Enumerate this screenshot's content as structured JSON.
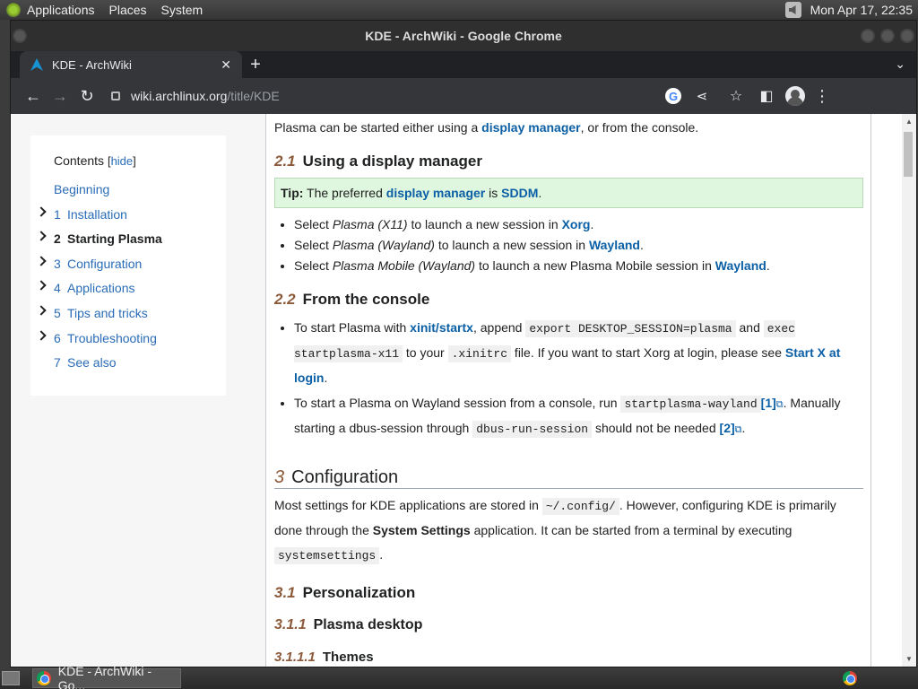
{
  "top_panel": {
    "menus": [
      "Applications",
      "Places",
      "System"
    ],
    "clock": "Mon Apr 17, 22:35"
  },
  "window": {
    "title": "KDE - ArchWiki - Google Chrome"
  },
  "tab": {
    "title": "KDE - ArchWiki",
    "close": "✕",
    "new": "+"
  },
  "address": {
    "host": "wiki.archlinux.org",
    "path": "/title/KDE"
  },
  "toc": {
    "title": "Contents",
    "hide_label": "hide",
    "items": [
      {
        "num": "",
        "label": "Beginning"
      },
      {
        "num": "1",
        "label": "Installation"
      },
      {
        "num": "2",
        "label": "Starting Plasma"
      },
      {
        "num": "3",
        "label": "Configuration"
      },
      {
        "num": "4",
        "label": "Applications"
      },
      {
        "num": "5",
        "label": "Tips and tricks"
      },
      {
        "num": "6",
        "label": "Troubleshooting"
      },
      {
        "num": "7",
        "label": "See also"
      }
    ]
  },
  "article": {
    "intro": {
      "pre": "Plasma can be started either using a ",
      "link": "display manager",
      "post": ", or from the console."
    },
    "s21": {
      "num": "2.1",
      "title": "Using a display manager"
    },
    "tip": {
      "label": "Tip:",
      "pre": " The preferred ",
      "link1": "display manager",
      "mid": " is ",
      "link2": "SDDM",
      "post": "."
    },
    "dm_list": [
      {
        "pre": "Select ",
        "em": "Plasma (X11)",
        "mid": " to launch a new session in ",
        "link": "Xorg",
        "post": "."
      },
      {
        "pre": "Select ",
        "em": "Plasma (Wayland)",
        "mid": " to launch a new session in ",
        "link": "Wayland",
        "post": "."
      },
      {
        "pre": "Select ",
        "em": "Plasma Mobile (Wayland)",
        "mid": " to launch a new Plasma Mobile session in ",
        "link": "Wayland",
        "post": "."
      }
    ],
    "s22": {
      "num": "2.2",
      "title": "From the console"
    },
    "console1": {
      "t1": "To start Plasma with ",
      "link1": "xinit/startx",
      "t2": ", append ",
      "code1": "export DESKTOP_SESSION=plasma",
      "t3": " and ",
      "code2": "exec startplasma-x11",
      "t4": " to your ",
      "code3": ".xinitrc",
      "t5": " file. If you want to start Xorg at login, please see ",
      "link2": "Start X at login",
      "t6": "."
    },
    "console2": {
      "t1": "To start a Plasma on Wayland session from a console, run ",
      "code1": "startplasma-wayland",
      "ref1": "[1]",
      "t2": ". Manually starting a dbus-session through ",
      "code2": "dbus-run-session",
      "t3": " should not be needed ",
      "ref2": "[2]",
      "t4": "."
    },
    "s3": {
      "num": "3",
      "title": "Configuration"
    },
    "config_p": {
      "t1": "Most settings for KDE applications are stored in ",
      "code1": "~/.config/",
      "t2": ". However, configuring KDE is primarily done through the ",
      "strong": "System Settings",
      "t3": " application. It can be started from a terminal by executing ",
      "code2": "systemsettings",
      "t4": "."
    },
    "s31": {
      "num": "3.1",
      "title": "Personalization"
    },
    "s311": {
      "num": "3.1.1",
      "title": "Plasma desktop"
    },
    "s3111": {
      "num": "3.1.1.1",
      "title": "Themes"
    }
  },
  "taskbar": {
    "task_label": "KDE - ArchWiki - Go..."
  }
}
